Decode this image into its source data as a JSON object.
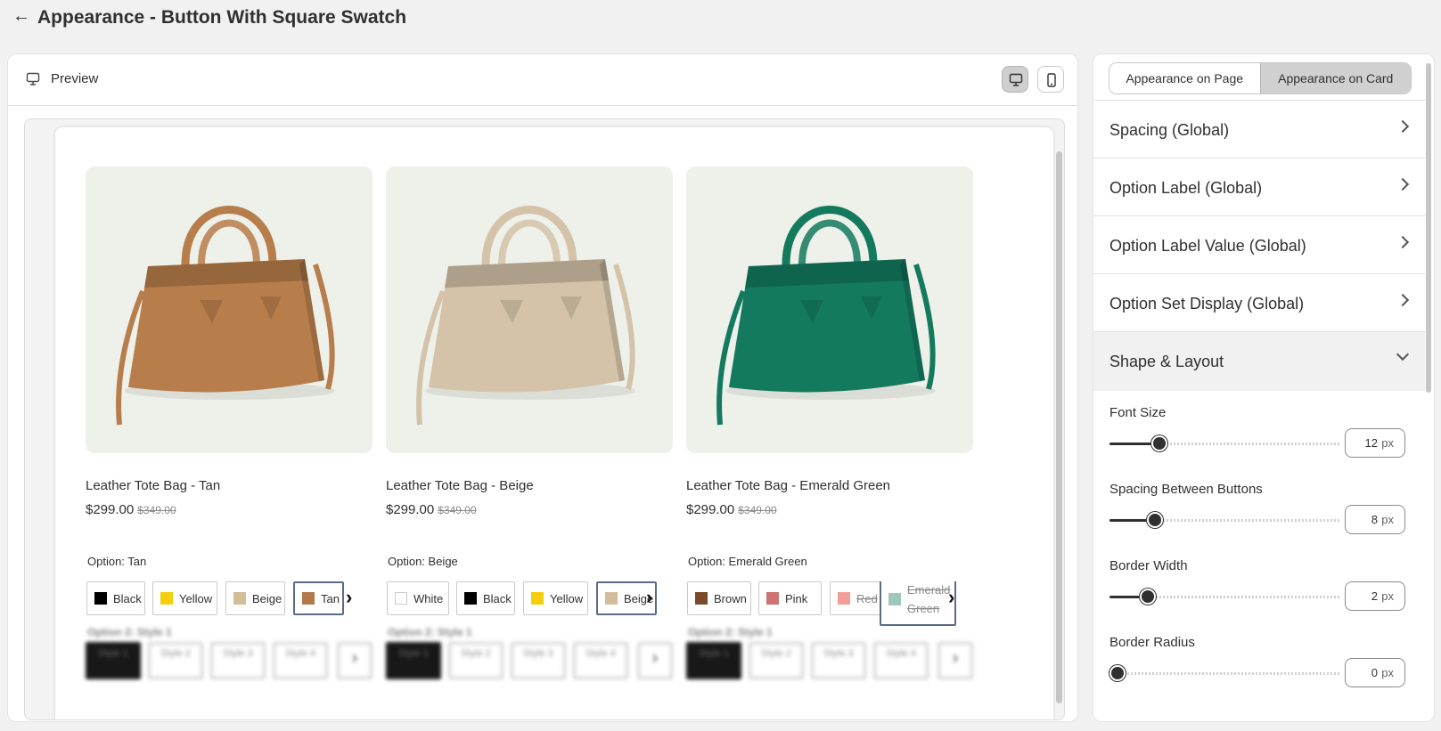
{
  "header": {
    "back_icon": "arrow-left-icon",
    "title": "Appearance - Button With Square Swatch"
  },
  "preview": {
    "label": "Preview",
    "devices": [
      {
        "name": "desktop",
        "active": true
      },
      {
        "name": "mobile",
        "active": false
      }
    ]
  },
  "products": [
    {
      "name": "Leather Tote Bag - Tan",
      "price": "$299.00",
      "compare_price": "$349.00",
      "bag_color": "#b77d4a",
      "option_label": "Option: Tan",
      "swatches": [
        {
          "label": "Black",
          "color": "#000000",
          "state": "normal"
        },
        {
          "label": "Yellow",
          "color": "#f4cf0e",
          "state": "normal"
        },
        {
          "label": "Beige",
          "color": "#d4bd9a",
          "state": "normal"
        },
        {
          "label": "Tan",
          "color": "#b4794a",
          "state": "selected"
        }
      ],
      "option2_label": "Option 2: Style 1",
      "styles": [
        "Style 1",
        "Style 2",
        "Style 3",
        "Style 4"
      ]
    },
    {
      "name": "Leather Tote Bag - Beige",
      "price": "$299.00",
      "compare_price": "$349.00",
      "bag_color": "#d4c3a8",
      "option_label": "Option: Beige",
      "swatches": [
        {
          "label": "White",
          "color": "#ffffff",
          "state": "normal"
        },
        {
          "label": "Black",
          "color": "#000000",
          "state": "normal"
        },
        {
          "label": "Yellow",
          "color": "#f4cf0e",
          "state": "normal"
        },
        {
          "label": "Beige",
          "color": "#d4bd9a",
          "state": "selected"
        }
      ],
      "option2_label": "Option 2: Style 1",
      "styles": [
        "Style 1",
        "Style 2",
        "Style 3",
        "Style 4"
      ]
    },
    {
      "name": "Leather Tote Bag - Emerald Green",
      "price": "$299.00",
      "compare_price": "$349.00",
      "bag_color": "#137a5e",
      "option_label": "Option: Emerald Green",
      "swatches": [
        {
          "label": "Brown",
          "color": "#7a4a2a",
          "state": "normal"
        },
        {
          "label": "Pink",
          "color": "#cf7272",
          "state": "normal"
        },
        {
          "label": "Red",
          "color": "#f09e96",
          "state": "disabled"
        },
        {
          "label": "Emerald Green",
          "color": "#9ec8bb",
          "state": "disabled-selected"
        }
      ],
      "option2_label": "Option 2: Style 1",
      "styles": [
        "Style 1",
        "Style 2",
        "Style 3",
        "Style 4"
      ]
    }
  ],
  "panel": {
    "tabs": [
      {
        "label": "Appearance on Page",
        "active": false
      },
      {
        "label": "Appearance on Card",
        "active": true
      }
    ],
    "sections": [
      {
        "label": "Spacing (Global)",
        "open": false
      },
      {
        "label": "Option Label (Global)",
        "open": false
      },
      {
        "label": "Option Label Value (Global)",
        "open": false
      },
      {
        "label": "Option Set Display (Global)",
        "open": false
      },
      {
        "label": "Shape & Layout",
        "open": true
      }
    ],
    "fields": [
      {
        "label": "Font Size",
        "value": "12",
        "unit": "px",
        "slider_fraction": 0.18
      },
      {
        "label": "Spacing Between Buttons",
        "value": "8",
        "unit": "px",
        "slider_fraction": 0.16
      },
      {
        "label": "Border Width",
        "value": "2",
        "unit": "px",
        "slider_fraction": 0.13
      },
      {
        "label": "Border Radius",
        "value": "0",
        "unit": "px",
        "slider_fraction": 0.0
      }
    ]
  },
  "colors": {
    "accent": "#303030",
    "selected_border": "#5b6a86",
    "page_bg": "#f1f1f1"
  }
}
